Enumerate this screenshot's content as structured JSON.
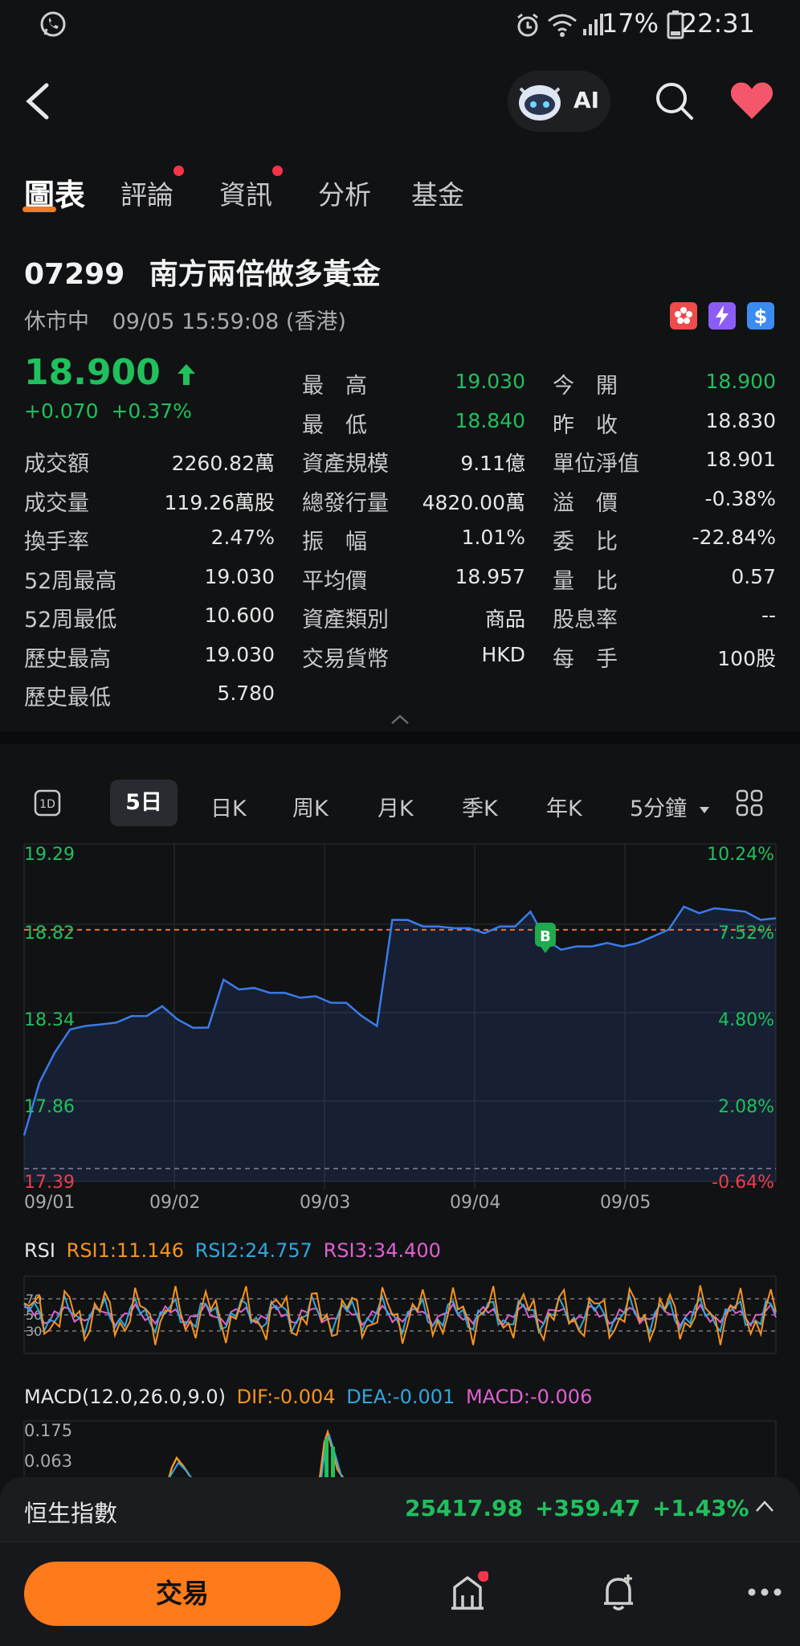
{
  "status_bar": {
    "battery": "17%",
    "time": "22:31"
  },
  "top_bar": {
    "ai_label": "AI"
  },
  "tabs": [
    {
      "label": "圖表",
      "active": true,
      "dot": false
    },
    {
      "label": "評論",
      "active": false,
      "dot": true
    },
    {
      "label": "資訊",
      "active": false,
      "dot": true
    },
    {
      "label": "分析",
      "active": false,
      "dot": false
    },
    {
      "label": "基金",
      "active": false,
      "dot": false
    }
  ],
  "stock": {
    "code": "07299",
    "name": "南方兩倍做多黃金",
    "status": "休市中",
    "datetime": "09/05 15:59:08 (香港)",
    "price": "18.900",
    "change": "+0.070",
    "change_pct": "+0.37%"
  },
  "stats": {
    "col1": [
      {
        "label": "成交額",
        "value": "2260.82萬"
      },
      {
        "label": "成交量",
        "value": "119.26萬股"
      },
      {
        "label": "換手率",
        "value": "2.47%"
      },
      {
        "label": "52周最高",
        "value": "19.030"
      },
      {
        "label": "52周最低",
        "value": "10.600"
      },
      {
        "label": "歷史最高",
        "value": "19.030"
      },
      {
        "label": "歷史最低",
        "value": "5.780"
      }
    ],
    "col2": [
      {
        "label": "最　高",
        "value": "19.030",
        "color": "green"
      },
      {
        "label": "最　低",
        "value": "18.840",
        "color": "green"
      },
      {
        "label": "資產規模",
        "value": "9.11億"
      },
      {
        "label": "總發行量",
        "value": "4820.00萬"
      },
      {
        "label": "振　幅",
        "value": "1.01%"
      },
      {
        "label": "平均價",
        "value": "18.957"
      },
      {
        "label": "資產類別",
        "value": "商品"
      },
      {
        "label": "交易貨幣",
        "value": "HKD"
      }
    ],
    "col3": [
      {
        "label": "今　開",
        "value": "18.900",
        "color": "green"
      },
      {
        "label": "昨　收",
        "value": "18.830"
      },
      {
        "label": "單位淨值",
        "value": "18.901"
      },
      {
        "label": "溢　價",
        "value": "-0.38%"
      },
      {
        "label": "委　比",
        "value": "-22.84%"
      },
      {
        "label": "量　比",
        "value": "0.57"
      },
      {
        "label": "股息率",
        "value": "--"
      },
      {
        "label": "每　手",
        "value": "100股"
      }
    ]
  },
  "periods": [
    "1D",
    "5日",
    "日K",
    "周K",
    "月K",
    "季K",
    "年K",
    "5分鐘"
  ],
  "active_period": "5日",
  "chart_data": {
    "type": "line",
    "x": [
      "09/01",
      "09/02",
      "09/03",
      "09/04",
      "09/05"
    ],
    "y_left_ticks": [
      "19.29",
      "18.82",
      "18.34",
      "17.86",
      "17.39"
    ],
    "y_right_ticks": [
      "10.24%",
      "7.52%",
      "4.80%",
      "2.08%",
      "-0.64%"
    ],
    "ylim": [
      17.39,
      19.29
    ],
    "prev_close": 18.83,
    "marker": "B",
    "series": [
      {
        "values": [
          17.6,
          17.9,
          18.1,
          18.22,
          18.26,
          18.25,
          18.28,
          18.3,
          18.32,
          18.36,
          18.3,
          18.23,
          18.25,
          18.52,
          18.48,
          18.47,
          18.46,
          18.44,
          18.43,
          18.42,
          18.4,
          18.38,
          18.32,
          18.24,
          18.9,
          18.88,
          18.86,
          18.84,
          18.85,
          18.83,
          18.82,
          18.84,
          18.86,
          18.93,
          18.78,
          18.7,
          18.74,
          18.72,
          18.76,
          18.72,
          18.76,
          18.78,
          18.84,
          18.96,
          18.94,
          18.95,
          18.96,
          18.93,
          18.9,
          18.89
        ]
      }
    ],
    "ylabel_unit": ""
  },
  "rsi": {
    "title": "RSI",
    "rsi1": "RSI1:11.146",
    "rsi2": "RSI2:24.757",
    "rsi3": "RSI3:34.400",
    "levels": [
      "70",
      "50",
      "30"
    ]
  },
  "macd": {
    "title": "MACD(12.0,26.0,9.0)",
    "dif": "DIF:-0.004",
    "dea": "DEA:-0.001",
    "macd": "MACD:-0.006",
    "ticks": [
      "0.175",
      "0.063"
    ]
  },
  "index_bar": {
    "name": "恒生指數",
    "value": "25417.98",
    "change": "+359.47",
    "change_pct": "+1.43%"
  },
  "bottom": {
    "trade_label": "交易"
  },
  "colors": {
    "up": "#20c05c",
    "down": "#ef3b4c",
    "accent": "#ff7a1a",
    "line": "#3b7be8",
    "rsi1": "#f7931e",
    "rsi2": "#2ea8e0",
    "rsi3": "#e060d0"
  }
}
